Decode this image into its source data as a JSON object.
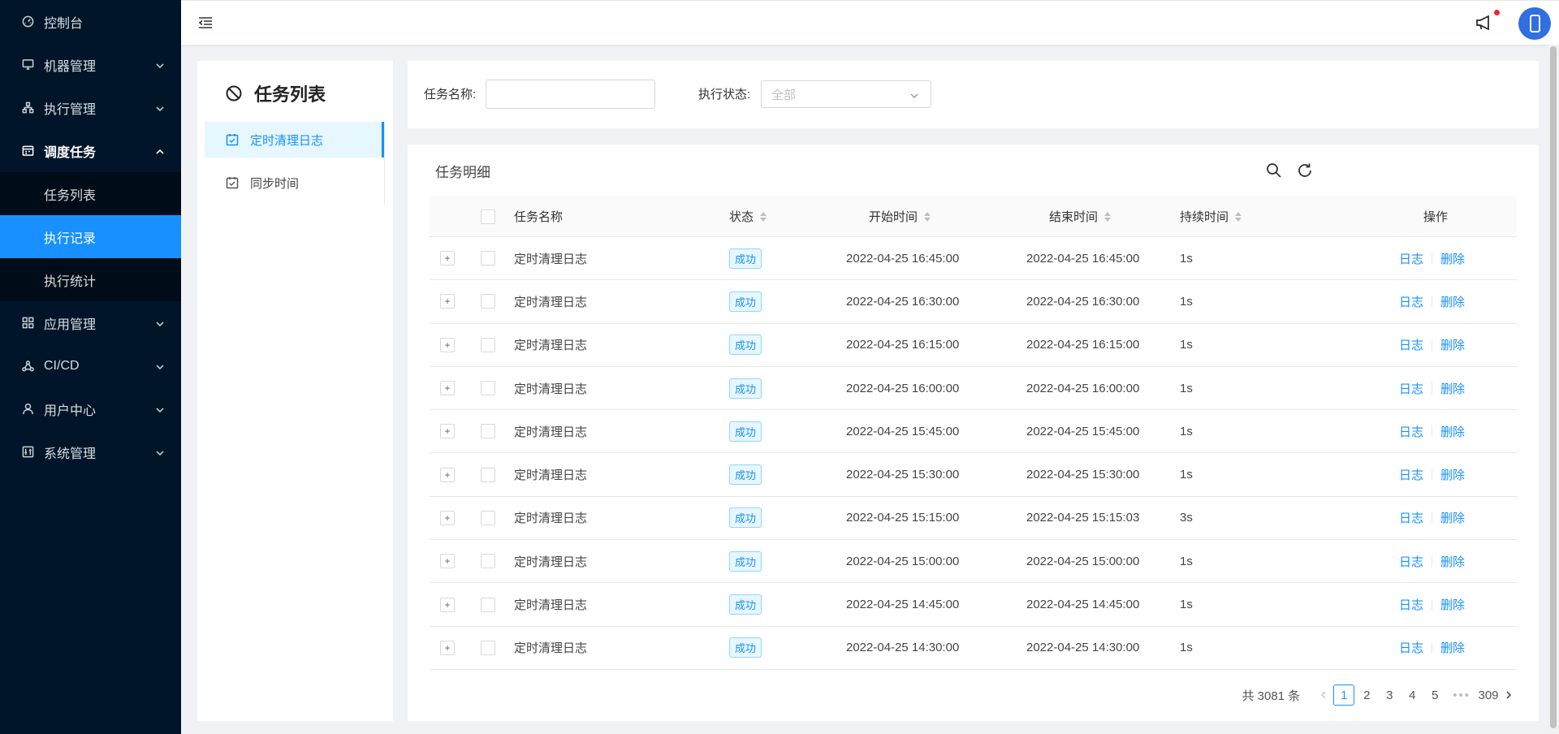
{
  "sidebar": {
    "items": [
      {
        "label": "控制台",
        "icon": "dashboard-icon"
      },
      {
        "label": "机器管理",
        "icon": "desktop-icon"
      },
      {
        "label": "执行管理",
        "icon": "cluster-icon"
      },
      {
        "label": "调度任务",
        "icon": "schedule-icon"
      },
      {
        "label": "应用管理",
        "icon": "appstore-icon"
      },
      {
        "label": "CI/CD",
        "icon": "deployment-icon"
      },
      {
        "label": "用户中心",
        "icon": "user-icon"
      },
      {
        "label": "系统管理",
        "icon": "setting-icon"
      }
    ],
    "submenu": [
      {
        "label": "任务列表"
      },
      {
        "label": "执行记录"
      },
      {
        "label": "执行统计"
      }
    ]
  },
  "task_panel": {
    "title": "任务列表",
    "items": [
      {
        "label": "定时清理日志"
      },
      {
        "label": "同步时间"
      }
    ]
  },
  "filter": {
    "name_label": "任务名称:",
    "name_value": "",
    "status_label": "执行状态:",
    "status_value": "全部"
  },
  "table": {
    "title": "任务明细",
    "columns": {
      "name": "任务名称",
      "status": "状态",
      "start": "开始时间",
      "end": "结束时间",
      "duration": "持续时间",
      "actions": "操作"
    },
    "expand_symbol": "+",
    "rows": [
      {
        "name": "定时清理日志",
        "status": "成功",
        "start": "2022-04-25 16:45:00",
        "end": "2022-04-25 16:45:00",
        "duration": "1s",
        "log": "日志",
        "delete": "删除"
      },
      {
        "name": "定时清理日志",
        "status": "成功",
        "start": "2022-04-25 16:30:00",
        "end": "2022-04-25 16:30:00",
        "duration": "1s",
        "log": "日志",
        "delete": "删除"
      },
      {
        "name": "定时清理日志",
        "status": "成功",
        "start": "2022-04-25 16:15:00",
        "end": "2022-04-25 16:15:00",
        "duration": "1s",
        "log": "日志",
        "delete": "删除"
      },
      {
        "name": "定时清理日志",
        "status": "成功",
        "start": "2022-04-25 16:00:00",
        "end": "2022-04-25 16:00:00",
        "duration": "1s",
        "log": "日志",
        "delete": "删除"
      },
      {
        "name": "定时清理日志",
        "status": "成功",
        "start": "2022-04-25 15:45:00",
        "end": "2022-04-25 15:45:00",
        "duration": "1s",
        "log": "日志",
        "delete": "删除"
      },
      {
        "name": "定时清理日志",
        "status": "成功",
        "start": "2022-04-25 15:30:00",
        "end": "2022-04-25 15:30:00",
        "duration": "1s",
        "log": "日志",
        "delete": "删除"
      },
      {
        "name": "定时清理日志",
        "status": "成功",
        "start": "2022-04-25 15:15:00",
        "end": "2022-04-25 15:15:03",
        "duration": "3s",
        "log": "日志",
        "delete": "删除"
      },
      {
        "name": "定时清理日志",
        "status": "成功",
        "start": "2022-04-25 15:00:00",
        "end": "2022-04-25 15:00:00",
        "duration": "1s",
        "log": "日志",
        "delete": "删除"
      },
      {
        "name": "定时清理日志",
        "status": "成功",
        "start": "2022-04-25 14:45:00",
        "end": "2022-04-25 14:45:00",
        "duration": "1s",
        "log": "日志",
        "delete": "删除"
      },
      {
        "name": "定时清理日志",
        "status": "成功",
        "start": "2022-04-25 14:30:00",
        "end": "2022-04-25 14:30:00",
        "duration": "1s",
        "log": "日志",
        "delete": "删除"
      }
    ]
  },
  "pagination": {
    "total_label": "共 3081 条",
    "pages": [
      "1",
      "2",
      "3",
      "4",
      "5"
    ],
    "ellipsis": "•••",
    "last": "309",
    "current": "1"
  },
  "colors": {
    "sidebar_bg": "#001529",
    "accent": "#1890ff"
  }
}
